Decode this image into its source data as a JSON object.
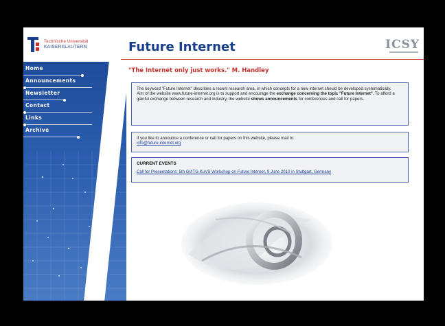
{
  "header": {
    "logo_line1": "Technische Universität",
    "logo_line2": "KAISERSLAUTERN",
    "title": "Future Internet",
    "brand": "ICSY"
  },
  "sidebar": {
    "items": [
      {
        "label": "Home"
      },
      {
        "label": "Announcements"
      },
      {
        "label": "Newsletter"
      },
      {
        "label": "Contact"
      },
      {
        "label": "Links"
      },
      {
        "label": "Archive"
      }
    ]
  },
  "main": {
    "quote": "\"The Internet only just works.\" M. Handley",
    "intro": {
      "p1": "The keyword \"Future Internet\" describes a recent research area, in which concepts for a new internet should be developed systematically.",
      "p2_a": "Aim of the website www.future-internet.org is to support and encourage the ",
      "p2_b": "exchange concerning the topic \"Future Internet\"",
      "p2_c": ". To afford a gainful exchange between research and industry, the website ",
      "p2_d": "shows announcements",
      "p2_e": " for conferences and call for papers."
    },
    "mail": {
      "text": "If you like to announce a conference or call for papers on this website, please mail to:",
      "email": "info@future-internet.org"
    },
    "events": {
      "heading": "CURRENT EVENTS",
      "link": "Call for Presentations: 5th GI/ITG KuVS Workshop on Future Internet, 9 June 2010 in Stuttgart, Germany"
    }
  },
  "colors": {
    "accent_red": "#c8312b",
    "brand_blue": "#1a3f8a",
    "sidebar_blue": "#2d5fb0",
    "box_border": "#4b62a6"
  }
}
